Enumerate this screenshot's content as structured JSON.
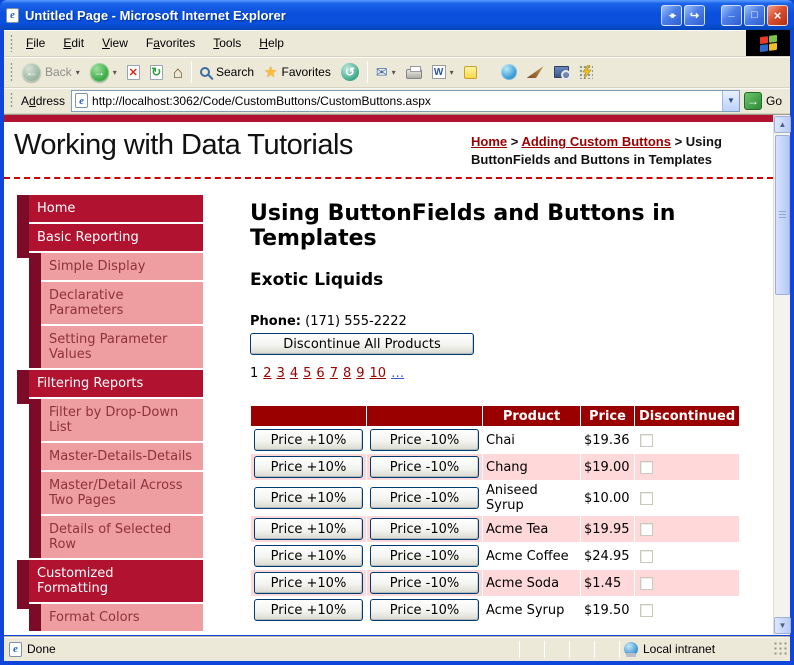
{
  "window": {
    "title": "Untitled Page - Microsoft Internet Explorer"
  },
  "menubar": {
    "items": [
      {
        "label": "File",
        "accel": 0
      },
      {
        "label": "Edit",
        "accel": 0
      },
      {
        "label": "View",
        "accel": 0
      },
      {
        "label": "Favorites",
        "accel": 1
      },
      {
        "label": "Tools",
        "accel": 0
      },
      {
        "label": "Help",
        "accel": 0
      }
    ]
  },
  "toolbar": {
    "back_label": "Back",
    "search_label": "Search",
    "favorites_label": "Favorites"
  },
  "addressbar": {
    "label": "Address",
    "url": "http://localhost:3062/Code/CustomButtons/CustomButtons.aspx",
    "go_label": "Go"
  },
  "header": {
    "site_title": "Working with Data Tutorials",
    "breadcrumb": [
      {
        "label": "Home",
        "link": true
      },
      {
        "label": "Adding Custom Buttons",
        "link": true
      },
      {
        "label": "Using ButtonFields and Buttons in Templates",
        "link": false
      }
    ]
  },
  "sidebar": {
    "items": [
      {
        "label": "Home",
        "level": 1
      },
      {
        "label": "Basic Reporting",
        "level": 1
      },
      {
        "label": "Simple Display",
        "level": 2
      },
      {
        "label": "Declarative Parameters",
        "level": 2
      },
      {
        "label": "Setting Parameter Values",
        "level": 2
      },
      {
        "label": "Filtering Reports",
        "level": 1
      },
      {
        "label": "Filter by Drop-Down List",
        "level": 2
      },
      {
        "label": "Master-Details-Details",
        "level": 2
      },
      {
        "label": "Master/Detail Across Two Pages",
        "level": 2
      },
      {
        "label": "Details of Selected Row",
        "level": 2
      },
      {
        "label": "Customized Formatting",
        "level": 1
      },
      {
        "label": "Format Colors",
        "level": 2
      }
    ]
  },
  "main": {
    "title": "Using ButtonFields and Buttons in Templates",
    "supplier": "Exotic Liquids",
    "phone_label": "Phone:",
    "phone": "(171) 555-2222",
    "discontinue_button": "Discontinue All Products"
  },
  "pager": {
    "items": [
      {
        "label": "1",
        "type": "current"
      },
      {
        "label": "2",
        "type": "page"
      },
      {
        "label": "3",
        "type": "page"
      },
      {
        "label": "4",
        "type": "page"
      },
      {
        "label": "5",
        "type": "page"
      },
      {
        "label": "6",
        "type": "page"
      },
      {
        "label": "7",
        "type": "page"
      },
      {
        "label": "8",
        "type": "page"
      },
      {
        "label": "9",
        "type": "page"
      },
      {
        "label": "10",
        "type": "page"
      },
      {
        "label": "…",
        "type": "more"
      }
    ]
  },
  "grid": {
    "headers": [
      "",
      "",
      "Product",
      "Price",
      "Discontinued"
    ],
    "button_plus": "Price +10%",
    "button_minus": "Price -10%",
    "rows": [
      {
        "product": "Chai",
        "price": "$19.36",
        "discontinued": false
      },
      {
        "product": "Chang",
        "price": "$19.00",
        "discontinued": false
      },
      {
        "product": "Aniseed Syrup",
        "price": "$10.00",
        "discontinued": false
      },
      {
        "product": "Acme Tea",
        "price": "$19.95",
        "discontinued": false
      },
      {
        "product": "Acme Coffee",
        "price": "$24.95",
        "discontinued": false
      },
      {
        "product": "Acme Soda",
        "price": "$1.45",
        "discontinued": false
      },
      {
        "product": "Acme Syrup",
        "price": "$19.50",
        "discontinued": false
      }
    ]
  },
  "statusbar": {
    "status": "Done",
    "zone": "Local intranet"
  },
  "colors": {
    "xp_blue": "#0F45DB",
    "sidebar_crimson": "#B1122F",
    "sidebar_marker_maroon": "#7C0B28",
    "sidebar_pink": "#EE9DA0",
    "link_red": "#990000",
    "grid_header_red": "#9B0000",
    "grid_alt_row_pink": "#FFD9D9"
  }
}
